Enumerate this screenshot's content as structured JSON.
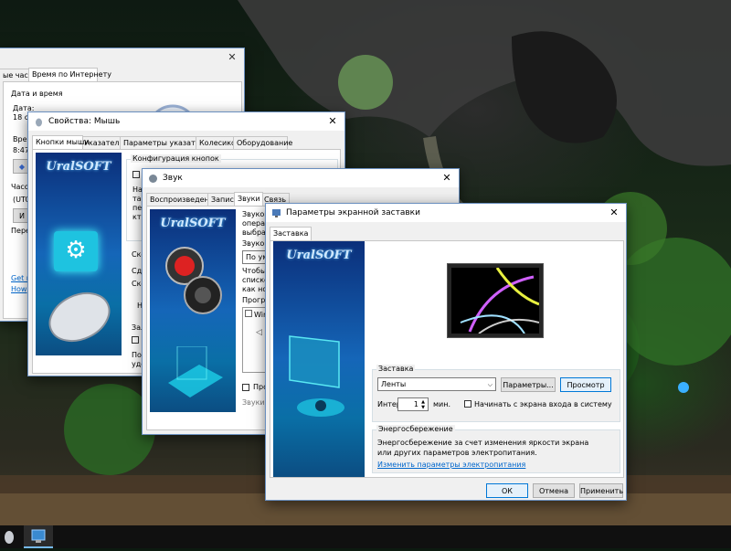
{
  "datetime_window": {
    "tabs": [
      "ые часы",
      "Время по Интернету"
    ],
    "section_title": "Дата и время",
    "date_label": "Дата:",
    "date_value": "18 с",
    "time_label": "Врем",
    "time_value": "8:47",
    "timezone_label": "Часо",
    "timezone_value": "(UTC",
    "change_button": "И",
    "dst_label": "Пере",
    "link_get": "Get n",
    "link_how": "How"
  },
  "mouse_window": {
    "title": "Свойства: Мышь",
    "tabs": [
      "Кнопки мыши",
      "Указатели",
      "Параметры указателя",
      "Колесико",
      "Оборудование"
    ],
    "group_title": "Конфигурация кнопок",
    "check1": "Об",
    "text1": "На",
    "text2": "так",
    "text3": "пер",
    "text4": "кто",
    "group2a": "Ско",
    "group2b": "Сд",
    "group2c": "Ско",
    "group2d": "Н",
    "lock_title": "Зал",
    "lock_check": "",
    "lock_text1": "Поз",
    "lock_text2": "уде",
    "lock_text3": "зад",
    "brand_logo": "UralSOFT"
  },
  "sound_window": {
    "title": "Звук",
    "tabs": [
      "Воспроизведение",
      "Запись",
      "Звуки",
      "Связь"
    ],
    "desc1": "Звукова",
    "desc2": "операц",
    "desc3": "выбрат",
    "scheme_label": "Звукова",
    "scheme_value": "По умо",
    "info1": "Чтобы и",
    "info2": "списке и",
    "info3": "как нов",
    "programs_label": "Програ",
    "program_item": "Win",
    "check_label": "Про",
    "sounds_label": "Звуки:",
    "brand_logo": "UralSOFT"
  },
  "screensaver_window": {
    "title": "Параметры экранной заставки",
    "tab": "Заставка",
    "brand_logo": "UralSOFT",
    "group_saver": "Заставка",
    "saver_value": "Ленты",
    "params_button": "Параметры...",
    "preview_button": "Просмотр",
    "interval_label": "Интер",
    "interval_value": "1",
    "minutes_label": "мин.",
    "logon_check_label": "Начинать с экрана входа в систему",
    "group_energy": "Энергосбережение",
    "energy_text": "Энергосбережение за счет изменения яркости экрана или других параметров электропитания.",
    "energy_link": "Изменить параметры электропитания",
    "ok_button": "ОК",
    "cancel_button": "Отмена",
    "apply_button": "Применить"
  },
  "taskbar": {
    "icons": [
      "mouse-icon",
      "screensaver-icon"
    ]
  },
  "colors": {
    "accent": "#0078d7",
    "link": "#0066cc",
    "brand_panel": "#1566b8"
  }
}
